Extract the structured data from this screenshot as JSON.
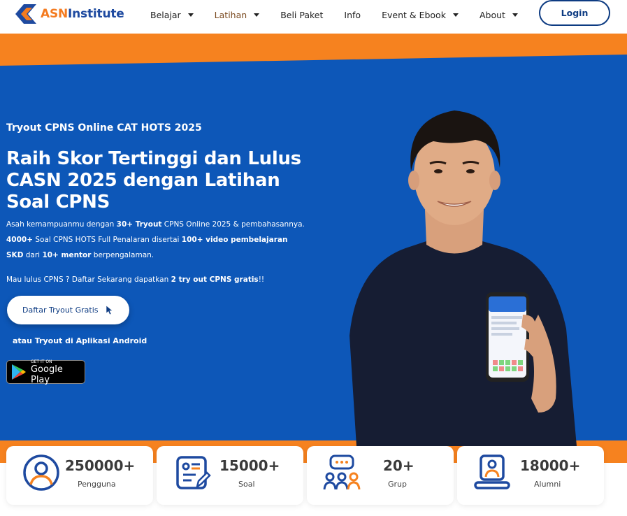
{
  "logo": {
    "part1": "ASN",
    "part2": "Institute"
  },
  "nav": {
    "items": [
      {
        "label": "Belajar",
        "has_dropdown": true
      },
      {
        "label": "Latihan",
        "has_dropdown": true
      },
      {
        "label": "Beli Paket",
        "has_dropdown": false
      },
      {
        "label": "Info",
        "has_dropdown": false
      },
      {
        "label": "Event & Ebook",
        "has_dropdown": true
      },
      {
        "label": "About",
        "has_dropdown": true
      }
    ],
    "login": "Login"
  },
  "hero": {
    "subtitle": "Tryout CPNS Online CAT HOTS 2025",
    "title": "Raih Skor Tertinggi dan Lulus CASN 2025 dengan Latihan Soal CPNS",
    "p1_a": "Asah kemampuanmu dengan ",
    "p1_b": "30+ Tryout",
    "p1_c": " CPNS Online 2025  & pembahasannya.",
    "p2_a": "4000+",
    "p2_b": " Soal CPNS HOTS Full Penalaran disertai ",
    "p2_c": "100+ video pembelajaran SKD",
    "p2_d": " dari ",
    "p2_e": "10+ mentor",
    "p2_f": " berpengalaman.",
    "p3_a": "Mau lulus CPNS ? Daftar Sekarang dapatkan ",
    "p3_b": "2 try out CPNS gratis",
    "p3_c": "!!",
    "cta": "Daftar Tryout Gratis",
    "or_text": "atau Tryout di Aplikasi Android",
    "gplay_small": "GET IT ON",
    "gplay_big": "Google Play"
  },
  "stats": [
    {
      "value": "250000+",
      "label": "Pengguna",
      "icon": "user-circle-icon"
    },
    {
      "value": "15000+",
      "label": "Soal",
      "icon": "document-edit-icon"
    },
    {
      "value": "20+",
      "label": "Grup",
      "icon": "group-chat-icon"
    },
    {
      "value": "18000+",
      "label": "Alumni",
      "icon": "alumni-laptop-icon"
    }
  ],
  "colors": {
    "primary_blue": "#0d57b8",
    "accent_orange": "#f6821f",
    "navy": "#0d3b82"
  }
}
